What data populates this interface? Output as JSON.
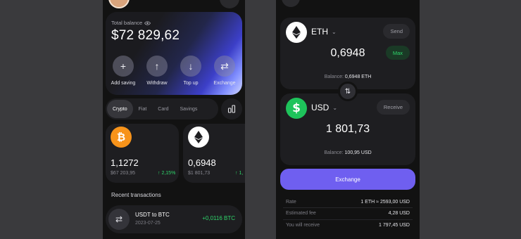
{
  "left": {
    "balance": {
      "label": "Total balance",
      "value": "$72 829,62"
    },
    "actions": [
      {
        "label": "Add saving",
        "icon": "plus-icon",
        "glyph": "+"
      },
      {
        "label": "Withdraw",
        "icon": "arrow-up-icon",
        "glyph": "↑"
      },
      {
        "label": "Top up",
        "icon": "arrow-down-icon",
        "glyph": "↓"
      },
      {
        "label": "Exchange",
        "icon": "swap-icon",
        "glyph": "⇄"
      }
    ],
    "tabs": [
      "Crypto",
      "Fiat",
      "Card",
      "Savings"
    ],
    "assets": [
      {
        "icon": "bitcoin-icon",
        "glyph": "₿",
        "amount": "1,1272",
        "fiat": "$67 203,95",
        "change": "↑ 2,15%"
      },
      {
        "icon": "ethereum-icon",
        "amount": "0,6948",
        "fiat": "$1 801,73",
        "change": "↑ 1,"
      }
    ],
    "recent": {
      "title": "Recent transactions",
      "items": [
        {
          "title": "USDT to BTC",
          "date": "2023-07-25",
          "amount": "+0,0116 BTC",
          "glyph": "⇄"
        }
      ]
    }
  },
  "right": {
    "from": {
      "currency": "ETH",
      "action": "Send",
      "amount": "0,6948",
      "max_label": "Max",
      "balance_label": "Balance:",
      "balance_value": "0,6948 ETH"
    },
    "swap_glyph": "⇅",
    "to": {
      "currency": "USD",
      "glyph": "$",
      "action": "Receive",
      "amount": "1 801,73",
      "balance_label": "Balance:",
      "balance_value": "100,95 USD"
    },
    "exchange_label": "Exchange",
    "info": [
      {
        "key": "Rate",
        "value": "1 ETH ≈ 2593,00 USD"
      },
      {
        "key": "Estimated fee",
        "value": "4,28 USD"
      },
      {
        "key": "You will receive",
        "value": "1 797,45 USD"
      }
    ]
  },
  "colors": {
    "accent": "#6f5ff0",
    "positive": "#2fd66b",
    "bitcoin": "#f7931a",
    "usd": "#1ec35b"
  }
}
